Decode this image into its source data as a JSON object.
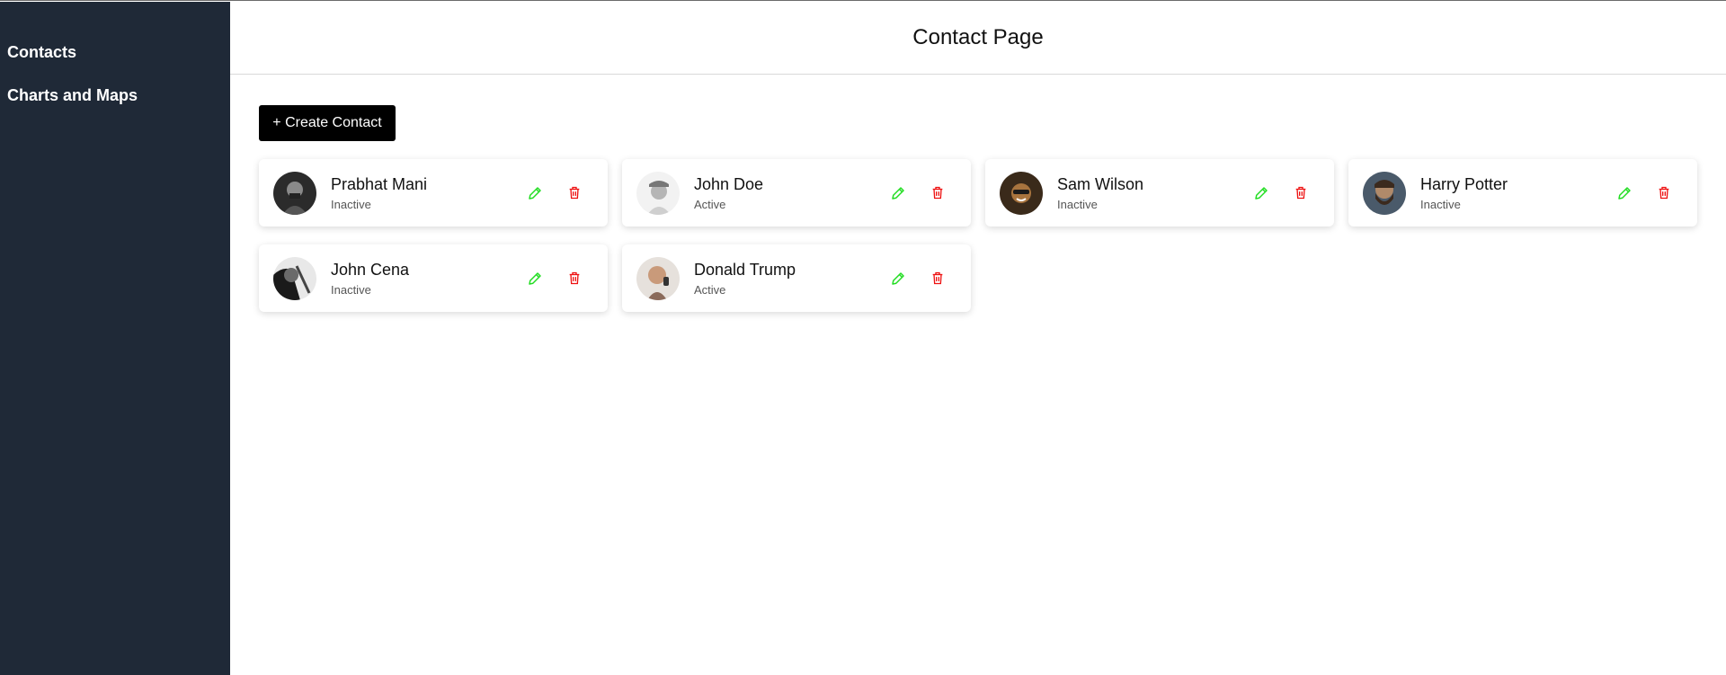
{
  "sidebar": {
    "items": [
      {
        "label": "Contacts"
      },
      {
        "label": "Charts and Maps"
      }
    ]
  },
  "header": {
    "title": "Contact Page"
  },
  "toolbar": {
    "create_label": "+ Create Contact"
  },
  "colors": {
    "sidebar_bg": "#1f2937",
    "edit": "#22dd22",
    "delete": "#ee1111",
    "button_bg": "#000000"
  },
  "contacts": [
    {
      "name": "Prabhat Mani",
      "status": "Inactive"
    },
    {
      "name": "John Doe",
      "status": "Active"
    },
    {
      "name": "Sam Wilson",
      "status": "Inactive"
    },
    {
      "name": "Harry Potter",
      "status": "Inactive"
    },
    {
      "name": "John Cena",
      "status": "Inactive"
    },
    {
      "name": "Donald Trump",
      "status": "Active"
    }
  ]
}
